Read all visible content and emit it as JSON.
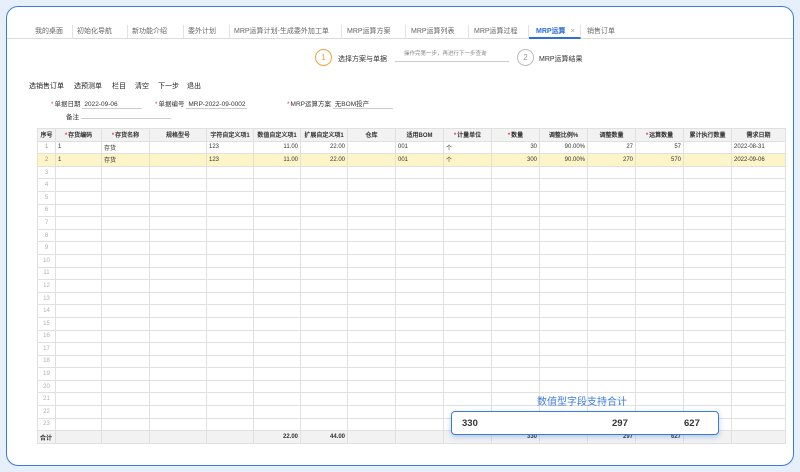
{
  "tabs": [
    "我的桌面",
    "初始化导航",
    "新功能介绍",
    "委外计划",
    "MRP运算计划-生成委外加工单",
    "MRP运算方案",
    "MRP运算列表",
    "MRP运算过程",
    "MRP运算",
    "销售订单"
  ],
  "tab_close": "×",
  "steps": {
    "step1_num": "1",
    "step1_label": "选择方案与单据",
    "hint": "操作完第一步，再进行下一步查询",
    "step2_num": "2",
    "step2_label": "MRP运算结果"
  },
  "toolbar": [
    "选销售订单",
    "选预测单",
    "栏目",
    "清空",
    "下一步",
    "退出"
  ],
  "form": {
    "date_label": "单据日期",
    "date_value": "2022-09-06",
    "code_label": "单据编号",
    "code_value": "MRP-2022-09-0002",
    "plan_label": "MRP运算方案",
    "plan_value": "无BOM投产",
    "note_label": "备注",
    "note_value": ""
  },
  "columns": [
    "序号",
    "存货编码",
    "存货名称",
    "规格型号",
    "字符自定义项1",
    "数值自定义项1",
    "扩展自定义项1",
    "仓库",
    "适用BOM",
    "计量单位",
    "数量",
    "调整比例%",
    "调整数量",
    "运算数量",
    "累计执行数量",
    "需求日期"
  ],
  "rows": [
    [
      "1",
      "1",
      "存货",
      "",
      "123",
      "11.00",
      "22.00",
      "",
      "001",
      "个",
      "30",
      "90.00%",
      "27",
      "57",
      "",
      "2022-08-31"
    ],
    [
      "2",
      "1",
      "存货",
      "",
      "123",
      "11.00",
      "22.00",
      "",
      "001",
      "个",
      "300",
      "90.00%",
      "270",
      "570",
      "",
      "2022-09-06"
    ]
  ],
  "empty_rows": [
    "3",
    "4",
    "5",
    "6",
    "7",
    "8",
    "9",
    "10",
    "11",
    "12",
    "13",
    "14",
    "15",
    "16",
    "17",
    "18",
    "19",
    "20",
    "21",
    "22",
    "23"
  ],
  "total": {
    "label": "合计",
    "num_custom": "22.00",
    "ext_custom": "44.00",
    "qty": "330",
    "adj_qty": "297",
    "calc_qty": "627"
  },
  "callout": {
    "title": "数值型字段支持合计",
    "qty": "330",
    "adj_qty": "297",
    "calc_qty": "627"
  },
  "colors": {
    "accent": "#3b7be0",
    "required": "#e04040",
    "selected_row": "#fdf5c8",
    "step_active": "#f0a040"
  }
}
